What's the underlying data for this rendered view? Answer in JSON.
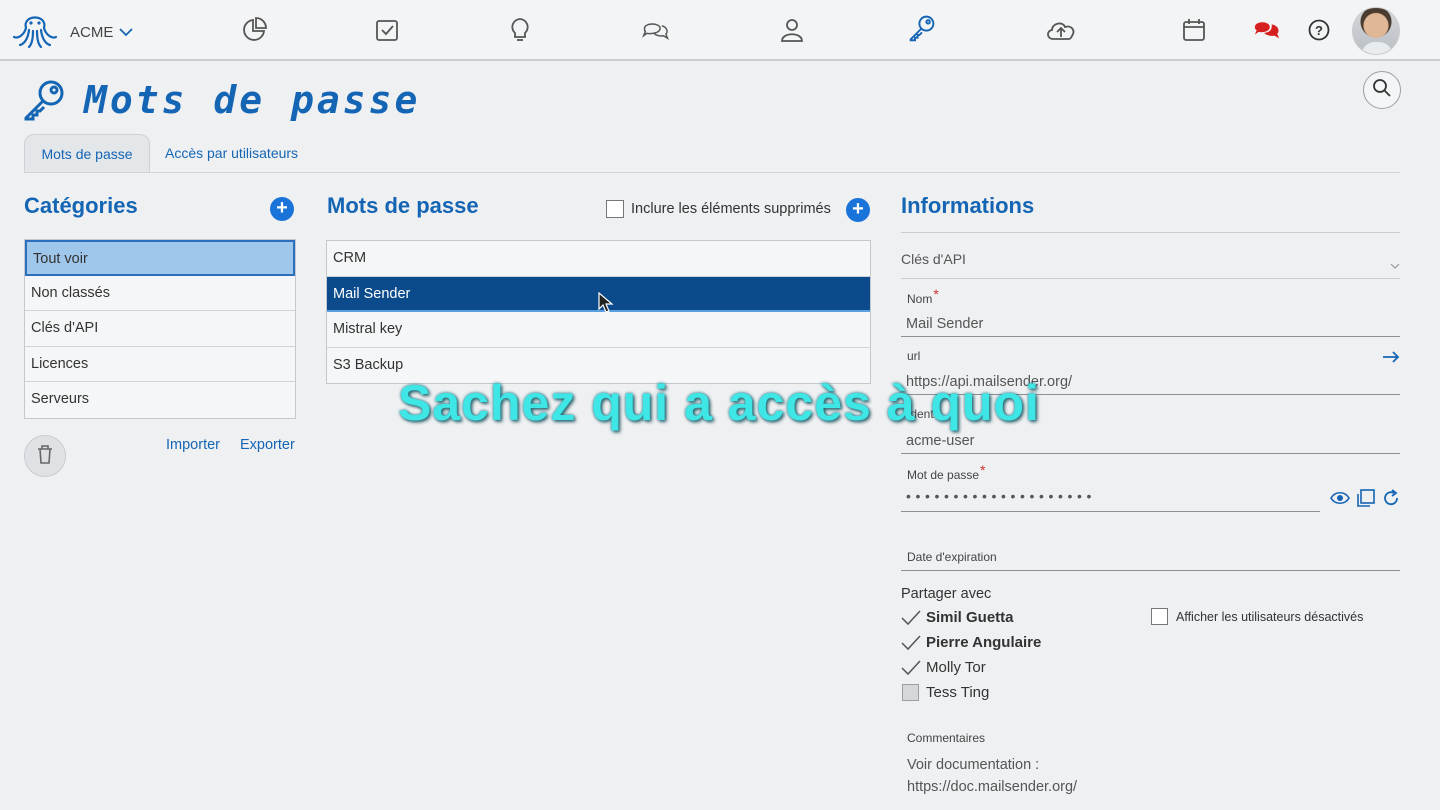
{
  "brand": {
    "name": "ACME"
  },
  "nav_icons": [
    "dashboard-icon",
    "tasks-icon",
    "ideas-icon",
    "chat-icon",
    "user-icon",
    "key-icon",
    "cloud-upload-icon",
    "calendar-icon",
    "messages-icon",
    "help-icon"
  ],
  "page": {
    "title": "Mots de passe"
  },
  "tabs": [
    {
      "label": "Mots de passe",
      "active": true
    },
    {
      "label": "Accès par utilisateurs",
      "active": false
    }
  ],
  "categories": {
    "heading": "Catégories",
    "items": [
      "Tout voir",
      "Non classés",
      "Clés d'API",
      "Licences",
      "Serveurs"
    ],
    "selected_index": 0,
    "import_label": "Importer",
    "export_label": "Exporter"
  },
  "passwords": {
    "heading": "Mots de passe",
    "include_deleted_label": "Inclure les éléments supprimés",
    "items": [
      "CRM",
      "Mail Sender",
      "Mistral key",
      "S3 Backup"
    ],
    "selected_index": 1
  },
  "info": {
    "heading": "Informations",
    "category_value": "Clés d'API",
    "name_label": "Nom",
    "name_value": "Mail Sender",
    "url_label": "url",
    "url_value": "https://api.mailsender.org/",
    "ident_label": "Ident",
    "ident_value": "acme-user",
    "password_label": "Mot de passe",
    "password_mask": "••••••••••••••••••••",
    "expiration_label": "Date d'expiration",
    "share_label": "Partager avec",
    "show_disabled_label": "Afficher les utilisateurs désactivés",
    "shared_users": [
      {
        "name": "Simil Guetta",
        "checked": true,
        "bold": true
      },
      {
        "name": "Pierre Angulaire",
        "checked": true,
        "bold": true
      },
      {
        "name": "Molly Tor",
        "checked": true,
        "bold": false
      },
      {
        "name": "Tess Ting",
        "checked": false,
        "bold": false
      }
    ],
    "comments_label": "Commentaires",
    "comments_line1": "Voir documentation :",
    "comments_line2": "https://doc.mailsender.org/"
  },
  "caption": "Sachez qui a accès à quoi",
  "colors": {
    "accent": "#1565b5",
    "selected_dark": "#0b4b8c",
    "selected_light": "#9fc7ec",
    "caption": "#3ee6e6"
  }
}
